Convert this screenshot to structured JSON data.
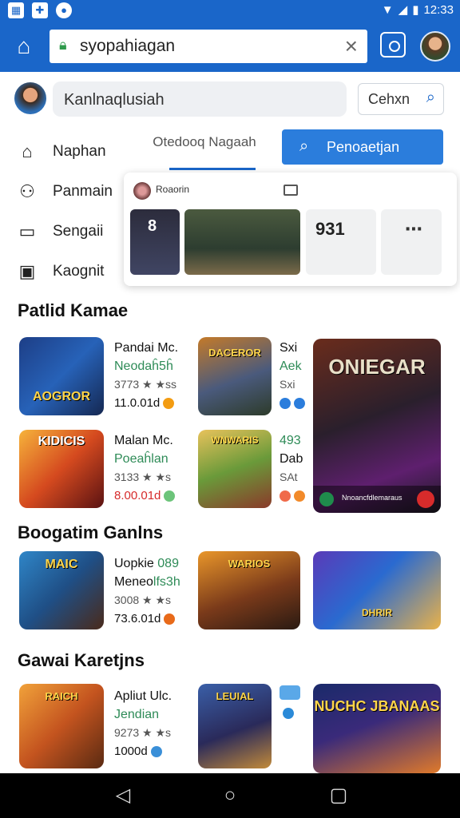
{
  "status": {
    "time": "12:33",
    "icons": [
      "image-icon",
      "game-icon",
      "message-icon",
      "wifi-icon",
      "signal-icon",
      "battery-icon"
    ]
  },
  "browser": {
    "url": "syopahiagan",
    "home": "home-icon",
    "clear": "×",
    "camera": "camera-icon"
  },
  "search": {
    "placeholder": "Kanlnaqlusiah",
    "button": "Cehxn"
  },
  "nav": [
    {
      "label": "Naphan",
      "icon": "⌂"
    },
    {
      "label": "Panmain",
      "icon": "⚇"
    },
    {
      "label": "Sengaii",
      "icon": "▭"
    },
    {
      "label": "Kaognit",
      "icon": "▣"
    }
  ],
  "tabs": {
    "inactive": "Otedooq Nagaah",
    "active": "Penoaetjan"
  },
  "popup": {
    "title": "Roaorin",
    "cards": [
      "8",
      "",
      "931",
      "⋯"
    ]
  },
  "sections": [
    {
      "title": "Patlid Kamae"
    },
    {
      "title": "Boogatim Ganlns"
    },
    {
      "title": "Gawai Karetjns"
    }
  ],
  "apps": {
    "a1": {
      "icon_text": "AOGROR",
      "name": "Pandai Mc.",
      "sub": "Neodaĥ5ĥ",
      "rating": "3773 ★ ★ss",
      "downloads": "11.0.01d"
    },
    "a2": {
      "icon_text": "DACEROR",
      "name": "Sxi",
      "sub": "Aek",
      "rating": "Sxi"
    },
    "a3": {
      "icon_text": "ONIEGAR",
      "footer": "Nnoancfdlemaraus"
    },
    "a4": {
      "icon_text": "KIDICIS",
      "name": "Malan Mc.",
      "sub": "Poeaĥlan",
      "rating": "3133 ★ ★s",
      "downloads": "8.00.01d"
    },
    "a5": {
      "icon_text": "WNWARIS",
      "name": "493",
      "sub": "Dab",
      "rating": "SAt"
    },
    "a6": {
      "icon_text": "MAIC",
      "name": "Uopkie",
      "sub": "Meneo",
      "extra": "089",
      "extra2": "lfs3h",
      "rating": "3008 ★ ★s",
      "downloads": "73.6.01d"
    },
    "a7": {
      "icon_text": "WARIOS",
      "name": "",
      "sub": ""
    },
    "a8": {
      "icon_text": "DHRIR",
      "name": "",
      "sub": ""
    },
    "a9": {
      "icon_text": "RAICH",
      "name": "Apliut Ulc.",
      "sub": "Jendian",
      "rating": "9273 ★ ★s",
      "downloads": "1000d"
    },
    "a10": {
      "icon_text": "LEUIAL",
      "name": "",
      "sub": ""
    },
    "a11": {
      "icon_text": "NUCHC JBANAAS",
      "name": "",
      "sub": ""
    }
  }
}
